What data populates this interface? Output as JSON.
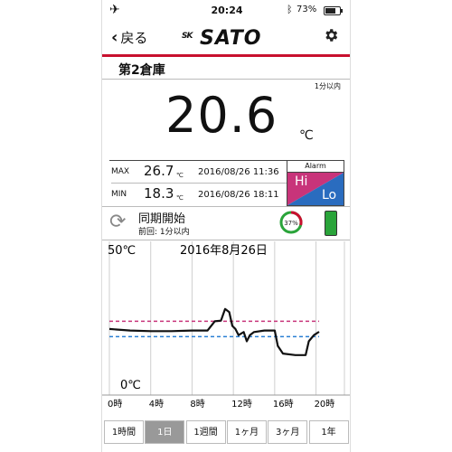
{
  "status_bar": {
    "time": "20:24",
    "battery_percent": "73%"
  },
  "nav": {
    "back_label": "戻る",
    "logo_mark": "SK",
    "logo_text": "SATO"
  },
  "location": {
    "name": "第2倉庫",
    "interval": "1分以内"
  },
  "current": {
    "value": "20.6",
    "unit": "℃"
  },
  "max": {
    "label": "MAX",
    "value": "26.7",
    "unit": "℃",
    "timestamp": "2016/08/26 11:36"
  },
  "min": {
    "label": "MIN",
    "value": "18.3",
    "unit": "℃",
    "timestamp": "2016/08/26 18:11"
  },
  "alarm": {
    "title": "Alarm",
    "hi": "Hi",
    "lo": "Lo"
  },
  "sync": {
    "title": "同期開始",
    "last": "前回: 1分以内",
    "battery_ring": "37%"
  },
  "chart_data": {
    "type": "line",
    "title": "2016年8月26日",
    "y_max_label": "50℃",
    "y_min_label": "0℃",
    "ylim": [
      0,
      50
    ],
    "xlim": [
      0,
      21
    ],
    "x_ticks": [
      "0時",
      "4時",
      "8時",
      "12時",
      "16時",
      "20時"
    ],
    "x_tick_values": [
      0,
      4,
      8,
      12,
      16,
      20
    ],
    "hi_threshold": 24,
    "lo_threshold": 19,
    "series": [
      {
        "x": [
          0,
          2,
          4,
          6,
          8,
          9.5,
          10.2,
          10.8,
          11.2,
          11.6,
          11.9,
          12.2,
          12.5,
          13.0,
          13.3,
          13.6,
          14.0,
          15.0,
          16.0,
          16.3,
          16.8,
          18,
          19,
          19.3,
          19.8,
          20.3
        ],
        "y": [
          21.5,
          21.0,
          20.8,
          20.8,
          21.0,
          21.0,
          24.0,
          24.2,
          28.0,
          27.0,
          22.5,
          21.5,
          19.5,
          20.5,
          17.5,
          19.5,
          20.5,
          21.0,
          21.0,
          16.0,
          13.5,
          13.0,
          13.0,
          17.5,
          19.5,
          20.6
        ]
      }
    ],
    "grid": true
  },
  "colors": {
    "hi_line": "#c8347a",
    "lo_line": "#2a7fd4",
    "series_line": "#111111"
  },
  "range_tabs": [
    "1時間",
    "1日",
    "1週間",
    "1ヶ月",
    "3ヶ月",
    "1年"
  ],
  "range_selected": "1日"
}
